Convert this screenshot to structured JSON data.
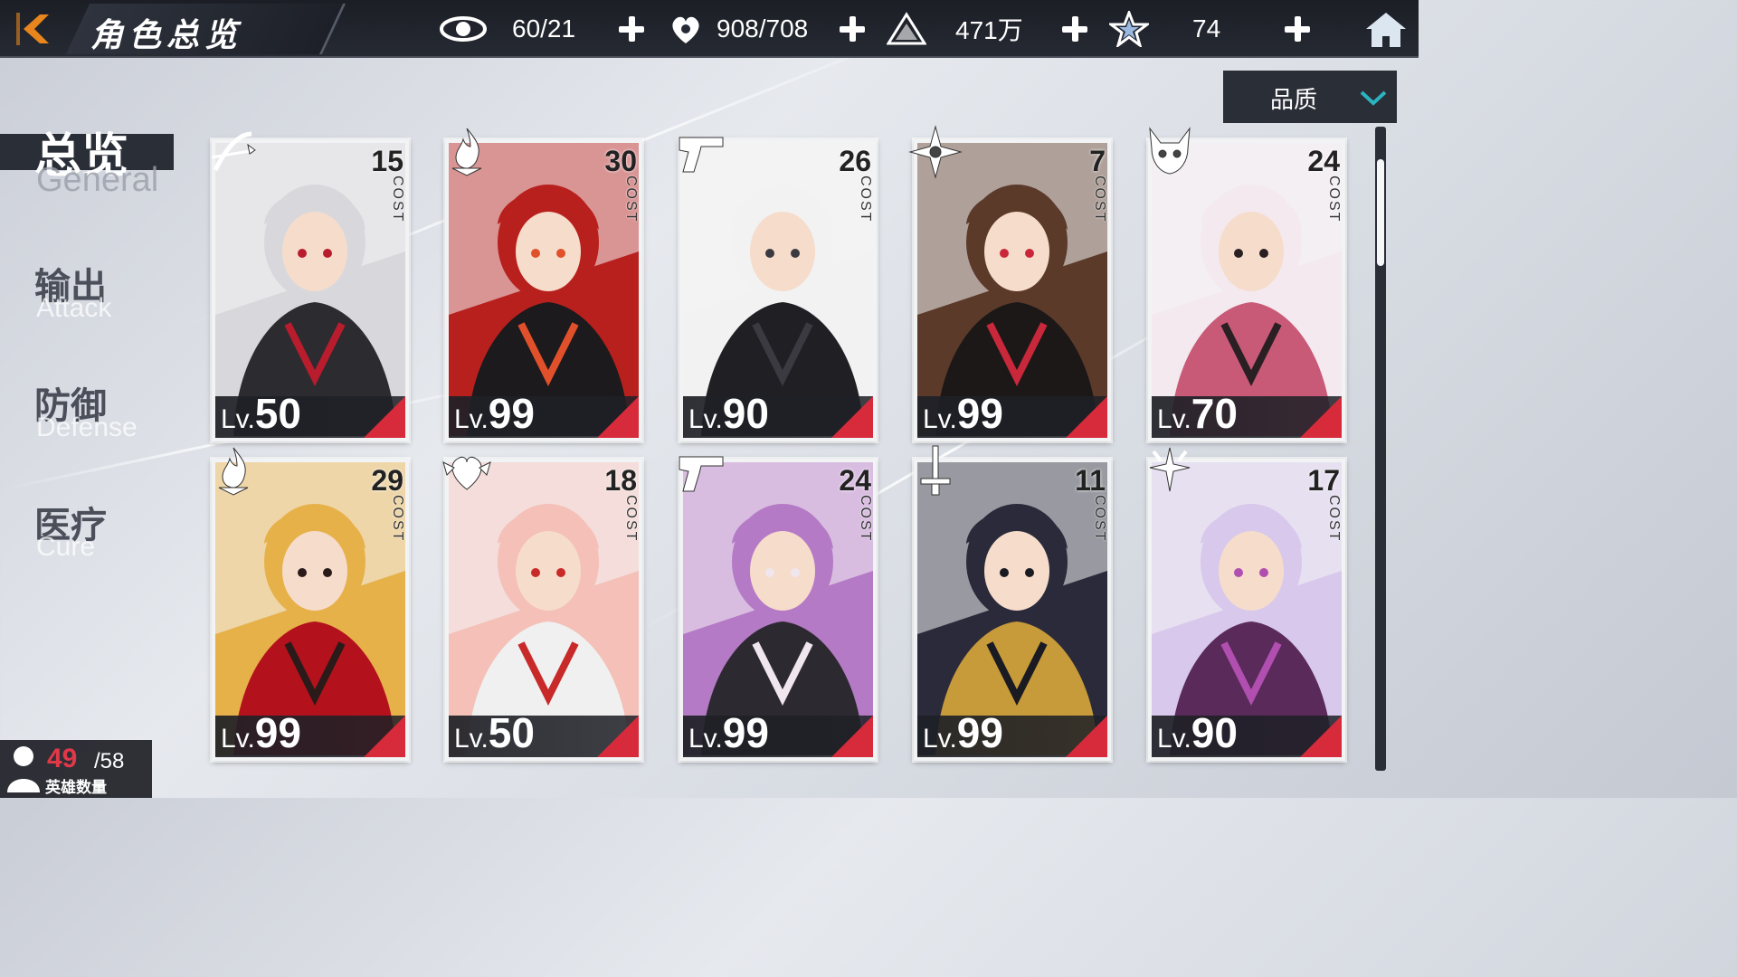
{
  "header": {
    "title": "角色总览",
    "resources": [
      {
        "icon": "eye-icon",
        "value": "60/21"
      },
      {
        "icon": "heart-potion-icon",
        "value": "908/708"
      },
      {
        "icon": "pyramid-coin-icon",
        "value": "471万"
      },
      {
        "icon": "star-shard-icon",
        "value": "74"
      }
    ]
  },
  "sidebar": {
    "items": [
      {
        "cn": "总览",
        "en": "General"
      },
      {
        "cn": "输出",
        "en": "Attack"
      },
      {
        "cn": "防御",
        "en": "Defense"
      },
      {
        "cn": "医疗",
        "en": "Cure"
      }
    ]
  },
  "sort": {
    "label": "品质"
  },
  "cost_label": "COST",
  "level_prefix": "Lv.",
  "cards": [
    {
      "cost": "15",
      "level": "50",
      "class_icon": "bow-icon",
      "palette": [
        "#d8d8dc",
        "#2b2b30",
        "#b91d2d"
      ]
    },
    {
      "cost": "30",
      "level": "99",
      "class_icon": "flame-icon",
      "palette": [
        "#b8201e",
        "#1c1a1c",
        "#e0502a"
      ]
    },
    {
      "cost": "26",
      "level": "90",
      "class_icon": "pistol-icon",
      "palette": [
        "#f2f2f2",
        "#1f1f24",
        "#3a3a40"
      ]
    },
    {
      "cost": "7",
      "level": "99",
      "class_icon": "shuriken-icon",
      "palette": [
        "#5b3a2a",
        "#1c1818",
        "#c9283a"
      ]
    },
    {
      "cost": "24",
      "level": "70",
      "class_icon": "demon-skull-icon",
      "palette": [
        "#f3e9ee",
        "#c85a78",
        "#2a2024"
      ]
    },
    {
      "cost": "29",
      "level": "99",
      "class_icon": "flame-icon",
      "palette": [
        "#e7b14a",
        "#b3121c",
        "#2a1a1a"
      ]
    },
    {
      "cost": "18",
      "level": "50",
      "class_icon": "heart-wings-icon",
      "palette": [
        "#f4c0b8",
        "#f0f0f0",
        "#c82a2a"
      ]
    },
    {
      "cost": "24",
      "level": "99",
      "class_icon": "pistol-icon",
      "palette": [
        "#b57ac6",
        "#2c2a30",
        "#f0e6ee"
      ]
    },
    {
      "cost": "11",
      "level": "99",
      "class_icon": "sword-icon",
      "palette": [
        "#2a2a3a",
        "#c79a3a",
        "#1a1a22"
      ]
    },
    {
      "cost": "17",
      "level": "90",
      "class_icon": "cross-shield-icon",
      "palette": [
        "#d7c8ec",
        "#5a2a5a",
        "#b04fb0"
      ]
    }
  ],
  "hero_count": {
    "current": "49",
    "total": "/58",
    "label": "英雄数量"
  },
  "colors": {
    "accent": "#e8861d",
    "dark_panel": "#2a2e37",
    "level_red": "#d72a3a"
  }
}
